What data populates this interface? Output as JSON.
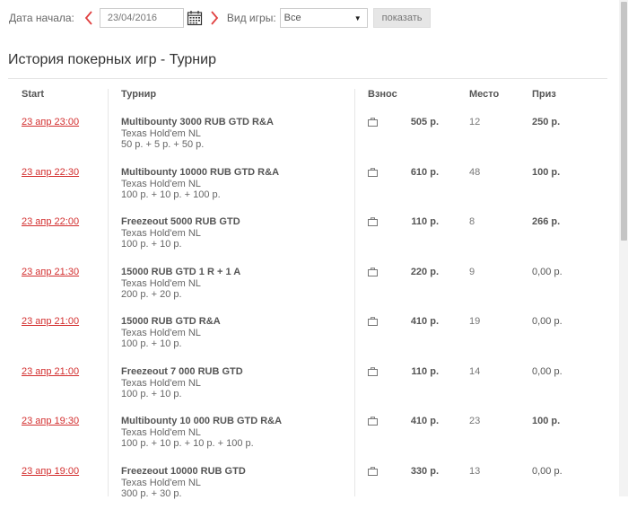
{
  "filter": {
    "start_date_label": "Дата начала:",
    "date_value": "23/04/2016",
    "game_type_label": "Вид игры:",
    "game_type_value": "Все",
    "show_button": "показать"
  },
  "page_title": "История покерных игр - Турнир",
  "columns": {
    "start": "Start",
    "tournament": "Турнир",
    "buyin": "Взнос",
    "place": "Место",
    "prize": "Приз"
  },
  "icons": {
    "prev": "chevron-left-icon",
    "next": "chevron-right-icon",
    "calendar": "calendar-icon",
    "bag": "buyin-bag-icon",
    "accent": "#e04040"
  },
  "rows": [
    {
      "start": "23 апр 23:00",
      "name": "Multibounty 3000 RUB GTD R&A",
      "game": "Texas Hold'em NL",
      "fee": "50 р. + 5 р. + 50 р.",
      "buyin": "505 р.",
      "place": "12",
      "prize": "250 р."
    },
    {
      "start": "23 апр 22:30",
      "name": "Multibounty 10000 RUB GTD R&A",
      "game": "Texas Hold'em NL",
      "fee": "100 р. + 10 р. + 100 р.",
      "buyin": "610 р.",
      "place": "48",
      "prize": "100 р."
    },
    {
      "start": "23 апр 22:00",
      "name": "Freezeout 5000 RUB GTD",
      "game": "Texas Hold'em NL",
      "fee": "100 р. + 10 р.",
      "buyin": "110 р.",
      "place": "8",
      "prize": "266 р."
    },
    {
      "start": "23 апр 21:30",
      "name": "15000 RUB GTD 1 R + 1 A",
      "game": "Texas Hold'em NL",
      "fee": "200 р. + 20 р.",
      "buyin": "220 р.",
      "place": "9",
      "prize": "0,00 р."
    },
    {
      "start": "23 апр 21:00",
      "name": "15000 RUB GTD R&A",
      "game": "Texas Hold'em NL",
      "fee": "100 р. + 10 р.",
      "buyin": "410 р.",
      "place": "19",
      "prize": "0,00 р."
    },
    {
      "start": "23 апр 21:00",
      "name": "Freezeout 7 000 RUB GTD",
      "game": "Texas Hold'em NL",
      "fee": "100 р. + 10 р.",
      "buyin": "110 р.",
      "place": "14",
      "prize": "0,00 р."
    },
    {
      "start": "23 апр 19:30",
      "name": "Multibounty 10 000 RUB GTD R&A",
      "game": "Texas Hold'em NL",
      "fee": "100 р. + 10 р. + 10 р. + 100 р.",
      "buyin": "410 р.",
      "place": "23",
      "prize": "100 р."
    },
    {
      "start": "23 апр 19:00",
      "name": "Freezeout 10000 RUB GTD",
      "game": "Texas Hold'em NL",
      "fee": "300 р. + 30 р.",
      "buyin": "330 р.",
      "place": "13",
      "prize": "0,00 р."
    }
  ]
}
